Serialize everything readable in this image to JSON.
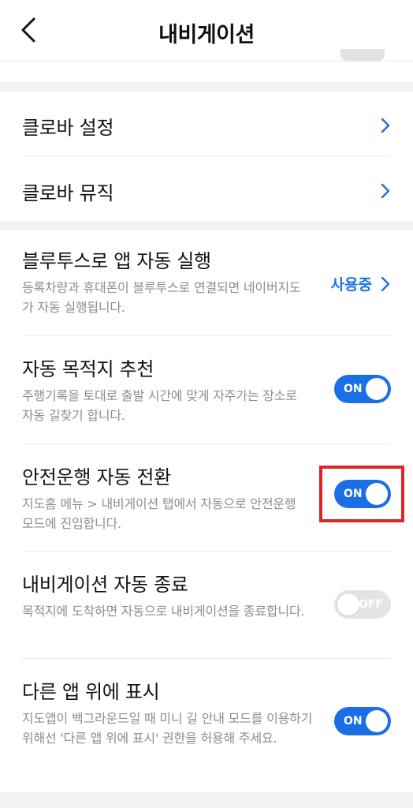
{
  "header": {
    "title": "내비게이션",
    "back_icon": "chevron-left-icon"
  },
  "clova": {
    "settings_label": "클로바 설정",
    "music_label": "클로바 뮤직"
  },
  "settings": [
    {
      "title": "블루투스로 앱 자동 실행",
      "desc": "등록차량과 휴대폰이 블루투스로 연결되면 네이버지도가 자동 실행됩니다.",
      "status": "사용중"
    },
    {
      "title": "자동 목적지 추천",
      "desc": "주행기록을 토대로 출발 시간에 맞게 자주가는 장소로 자동 길찾기 합니다.",
      "toggle": "ON"
    },
    {
      "title": "안전운행 자동 전환",
      "desc": "지도홈 메뉴 > 내비게이션 탭에서 자동으로 안전운행 모드에 진입합니다.",
      "toggle": "ON"
    },
    {
      "title": "내비게이션 자동 종료",
      "desc": "목적지에 도착하면 자동으로 내비게이션을 종료합니다.",
      "toggle": "OFF"
    },
    {
      "title": "다른 앱 위에 표시",
      "desc": "지도앱이 백그라운드일 때 미니 길 안내 모드를 이용하기 위해선 '다른 앱 위에 표시' 권한을 허용해 주세요.",
      "toggle": "ON"
    }
  ],
  "colors": {
    "accent": "#1a6fe6",
    "highlight": "#e02424",
    "off": "#e3e4e8"
  }
}
